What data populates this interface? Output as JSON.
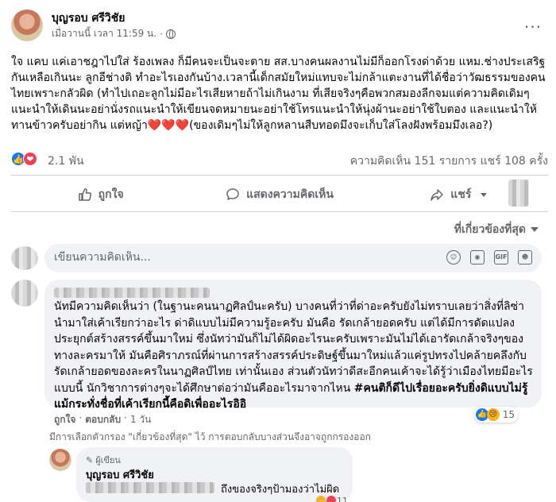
{
  "post": {
    "author": "บุญรอบ ศรีวิชัย",
    "time": "เมื่อวานนี้ เวลา 11:59 น.",
    "time_sep": "·",
    "more": "···",
    "text": "ใจ แคบ แค่เอาชฎาไปใส่ ร้องเพลง ก็มีคนจะเป็นจะตาย สส.บางคนผลงานไม่มีก็ออกโรงด่าด้วย แหม.ช่างประเสริฐกันเหลือเกินนะ ลูกอีช่างติ ทำอะไรเองกันบ้าง.เวลานี้เด็กสมัยใหม่แทบจะไม่กล้าแตะงานที่ได้ชื่อว่าวัฒธรรมของคนไทยเพราะกลัวผิด (ทำไปเถอะลูกไม่มีอะไรเสียหายถ้าไม่เกินงาม ที่เสียจริงๆคือพวกสมองลีกจมแต่ความคิดเดิมๆแนะนำให้เดินนะอย่านั่งรถแนะนำให้เขียนจดหมายนะอย่าใช้โทรแนะนำให้นุ่งผ้านะอย่าใช้ใบตอง และแนะนำให้ ทานข้าวครับอย่ากิน แต่หญ้า❤️❤️❤️(ของเดิมๆไม่ให้ลูกหลานสืบทอดมึงจะเก็บใส่โลงฝังพร้อมมึงเลอ?)"
  },
  "reactions": {
    "like_icon": "👍",
    "love_icon": "❤",
    "count": "2.1 พัน",
    "stats": "ความคิดเห็น 151 รายการ   แชร์ 108 ครั้ง"
  },
  "actions": [
    {
      "label": "ถูกใจ",
      "icon": "thumb-up-icon",
      "glyph": "👍"
    },
    {
      "label": "แสดงความคิดเห็น",
      "icon": "comment-icon",
      "glyph": "🗨"
    },
    {
      "label": "แชร์",
      "icon": "share-icon",
      "glyph": "➦"
    }
  ],
  "sort": {
    "label": "ที่เกี่ยวข้องที่สุด"
  },
  "comment_box": {
    "placeholder": "เขียนความคิดเห็น...",
    "icons": [
      "emoji-icon",
      "camera-icon",
      "gif-icon",
      "sticker-icon"
    ],
    "gif_label": "GIF"
  },
  "comment": {
    "text_normal": "นัทมีความคิดเห็นว่า (ในฐานะคนนาฏศิลป์นะครับ) บางคนที่ว่าที่ด่าอะครับยังไม่ทราบเลยว่าสิ่งที่ลิซ่านำมาใส่เค้าเรียกว่าอะไร ด่าดิแบบไม่มีความรู้อะครับ มันคือ รัดเกล้ายอดครับ แต่ได้มีการดัดแปลงประยุกต์สร้างสรรค์ขึ้นมาใหม่ ซึ่งนัทว่ามันก็ไม่ได้ผิดอะไรนะครับเพราะมันไม่ได้เอารัดเกล้าจริงๆของทางละครมาให้ มันคือศิราภรณ์ที่ผ่านการสร้างสรรค์ประดิษฐ์ขึ้นมาใหม่แล้วแค่รูปทรงไปคล้ายคลึงกับรัดเกล้ายอดของละครในนาฏศิลป์ไทย เท่านั้นเอง ส่วนตัวนัทว่าดีสะอีกคนเค้าจะได้รู้ว่าเมืองไทยมีอะไรแบบนี้ นักวิชาการต่างๆจะได้ศึกษาต่อว่ามันคืออะไรมาจากไหน ",
    "text_bold": "#คนติก็ดีไปเรื่อยอะครับยิ่งดิแบบไม่รู้แม้กระทั่งชื่อที่เค้าเรียกนี้คือดิเพื่ออะไรอิอิ",
    "like_label": "ถูกใจ",
    "reply_label": "ตอบกลับ",
    "age": "1 วัน",
    "sep": "·",
    "react_count": "15",
    "like_icon": "👍",
    "sad_icon": "😢"
  },
  "filter_note": "มีการเลือกตัวกรอง \"เกี่ยวข้องที่สุด\" ไว้ การตอบกลับบางส่วนจึงอาจถูกกรองออก",
  "reply": {
    "badge": "ผู้เขียน",
    "badge_icon": "✎",
    "author": "บุญรอบ ศรีวิชัย",
    "text": "ถึงของจริงๆป้ามองว่าไม่ผิด",
    "react_count": "11"
  }
}
